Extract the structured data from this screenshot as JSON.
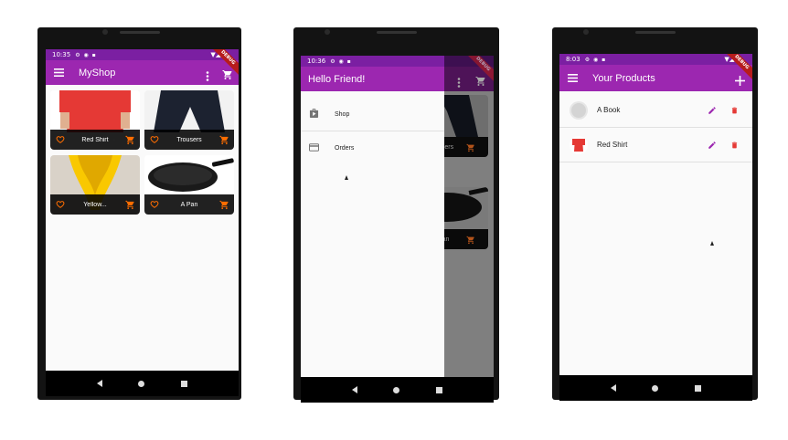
{
  "colors": {
    "primary": "#9c27b0",
    "status_bar": "#7b1fa2",
    "accent": "#ff6d00",
    "danger": "#e53935",
    "scrim": "#7f7f7f"
  },
  "phone1": {
    "status": {
      "time": "10:35",
      "icons": "⚙ ◉ ▪"
    },
    "appbar": {
      "title": "MyShop",
      "menu_icon": "hamburger-icon",
      "more_icon": "more-vert-icon",
      "cart_icon": "shopping-cart-icon"
    },
    "debug_banner": "DEBUG",
    "products": [
      {
        "name": "Red Shirt"
      },
      {
        "name": "Trousers"
      },
      {
        "name": "Yellow..."
      },
      {
        "name": "A Pan"
      }
    ]
  },
  "phone2": {
    "status": {
      "time": "10:36",
      "icons": "⚙ ◉ ▪"
    },
    "drawer": {
      "header": "Hello Friend!",
      "items": [
        {
          "label": "Shop",
          "icon": "shop-icon"
        },
        {
          "label": "Orders",
          "icon": "credit-card-icon"
        }
      ]
    },
    "background_labels": [
      "users",
      "Pan"
    ],
    "debug_banner": "DEBUG"
  },
  "phone3": {
    "status": {
      "time": "8:03",
      "icons": "⚙ ◉ ▪"
    },
    "appbar": {
      "title": "Your Products",
      "add_icon": "add-icon"
    },
    "debug_banner": "DEBUG",
    "products": [
      {
        "title": "A Book"
      },
      {
        "title": "Red Shirt"
      }
    ]
  }
}
